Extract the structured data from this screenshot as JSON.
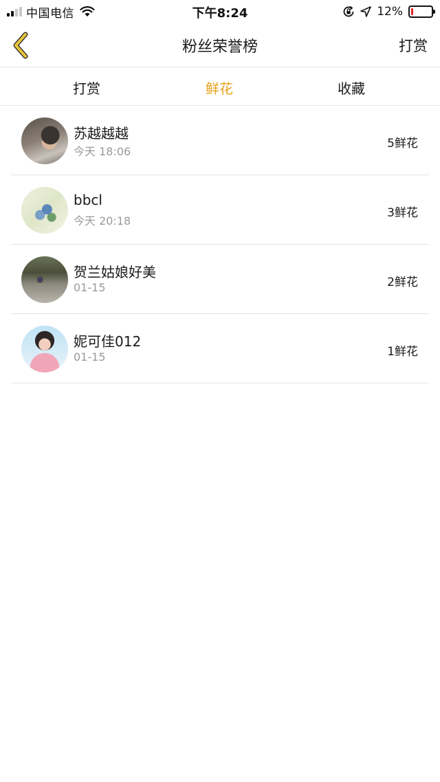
{
  "status_bar": {
    "carrier": "中国电信",
    "time": "下午8:24",
    "battery_percent": "12%",
    "battery_level": 0.12,
    "signal_bars": 4,
    "signal_active": 2,
    "icons": [
      "wifi-icon",
      "rotation-lock-icon",
      "location-icon",
      "battery-icon"
    ]
  },
  "nav": {
    "title": "粉丝荣誉榜",
    "right_action": "打赏",
    "back_icon": "chevron-left-icon",
    "back_color": "#e8c53a"
  },
  "tabs": [
    {
      "label": "打赏",
      "active": false
    },
    {
      "label": "鲜花",
      "active": true
    },
    {
      "label": "收藏",
      "active": false
    }
  ],
  "accent_color": "#e8a21c",
  "rows": [
    {
      "name": "苏越越越",
      "time": "今天 18:06",
      "count": "5鲜花"
    },
    {
      "name": "bbcl",
      "time": "今天 20:18",
      "count": "3鲜花"
    },
    {
      "name": "贺兰姑娘好美",
      "time": "01-15",
      "count": "2鲜花"
    },
    {
      "name": "妮可佳012",
      "time": "01-15",
      "count": "1鲜花"
    }
  ]
}
